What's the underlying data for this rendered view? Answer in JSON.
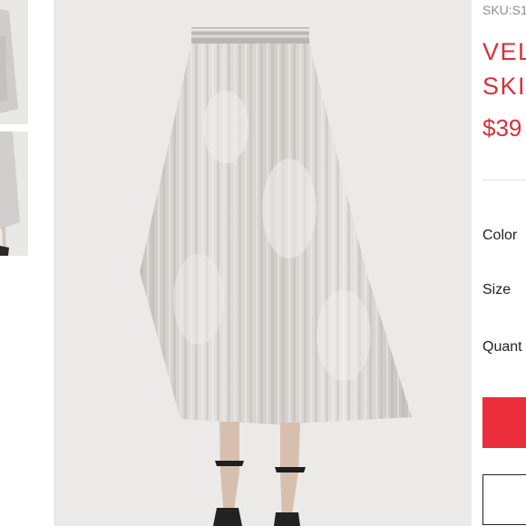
{
  "thumbnails": [
    {
      "icon": "skirt-thumbnail"
    },
    {
      "icon": "skirt-thumbnail"
    }
  ],
  "product": {
    "sku": "SKU:S1",
    "title_line1": "VEL",
    "title_line2": "SKI",
    "price": "$39"
  },
  "options": {
    "color_label": "Color",
    "size_label": "Size",
    "quantity_label": "Quant"
  },
  "colors": {
    "accent": "#d9303a",
    "button": "#ec2d3c"
  }
}
